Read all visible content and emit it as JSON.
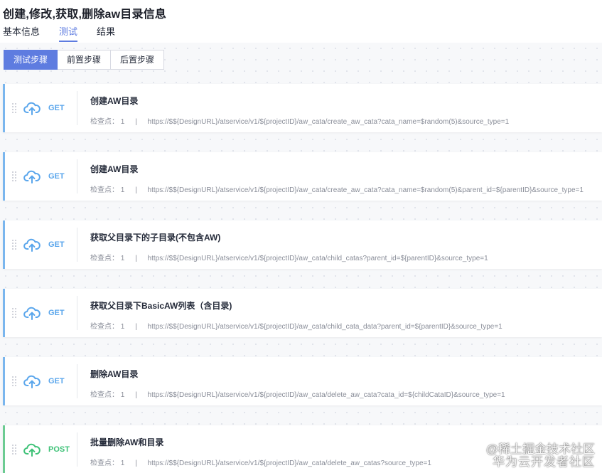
{
  "page": {
    "title": "创建,修改,获取,删除aw目录信息"
  },
  "tabs": [
    {
      "label": "基本信息",
      "active": false
    },
    {
      "label": "测试",
      "active": true
    },
    {
      "label": "结果",
      "active": false
    }
  ],
  "step_filter": [
    {
      "label": "测试步骤",
      "active": true
    },
    {
      "label": "前置步骤",
      "active": false
    },
    {
      "label": "后置步骤",
      "active": false
    }
  ],
  "step_meta": {
    "checkpoint_label": "检查点：",
    "separator": "|"
  },
  "steps": [
    {
      "method": "GET",
      "title": "创建AW目录",
      "checkpoints": "1",
      "url": "https://$${DesignURL}/atservice/v1/${projectID}/aw_cata/create_aw_cata?cata_name=$random(5)&source_type=1"
    },
    {
      "method": "GET",
      "title": "创建AW目录",
      "checkpoints": "1",
      "url": "https://$${DesignURL}/atservice/v1/${projectID}/aw_cata/create_aw_cata?cata_name=$random(5)&parent_id=${parentID}&source_type=1"
    },
    {
      "method": "GET",
      "title": "获取父目录下的子目录(不包含AW)",
      "checkpoints": "1",
      "url": "https://$${DesignURL}/atservice/v1/${projectID}/aw_cata/child_catas?parent_id=${parentID}&source_type=1"
    },
    {
      "method": "GET",
      "title": "获取父目录下BasicAW列表（含目录)",
      "checkpoints": "1",
      "url": "https://$${DesignURL}/atservice/v1/${projectID}/aw_cata/child_cata_data?parent_id=${parentID}&source_type=1"
    },
    {
      "method": "GET",
      "title": "删除AW目录",
      "checkpoints": "1",
      "url": "https://$${DesignURL}/atservice/v1/${projectID}/aw_cata/delete_aw_cata?cata_id=${childCataID}&source_type=1"
    },
    {
      "method": "POST",
      "title": "批量删除AW和目录",
      "checkpoints": "1",
      "url": "https://$${DesignURL}/atservice/v1/${projectID}/aw_cata/delete_aw_catas?source_type=1"
    }
  ],
  "watermark": {
    "line1": "@稀土掘金技术社区",
    "line2": "华为云开发者社区"
  },
  "colors": {
    "accent": "#5e7ce0",
    "get": "#5aa6ec",
    "post": "#3fc278"
  }
}
